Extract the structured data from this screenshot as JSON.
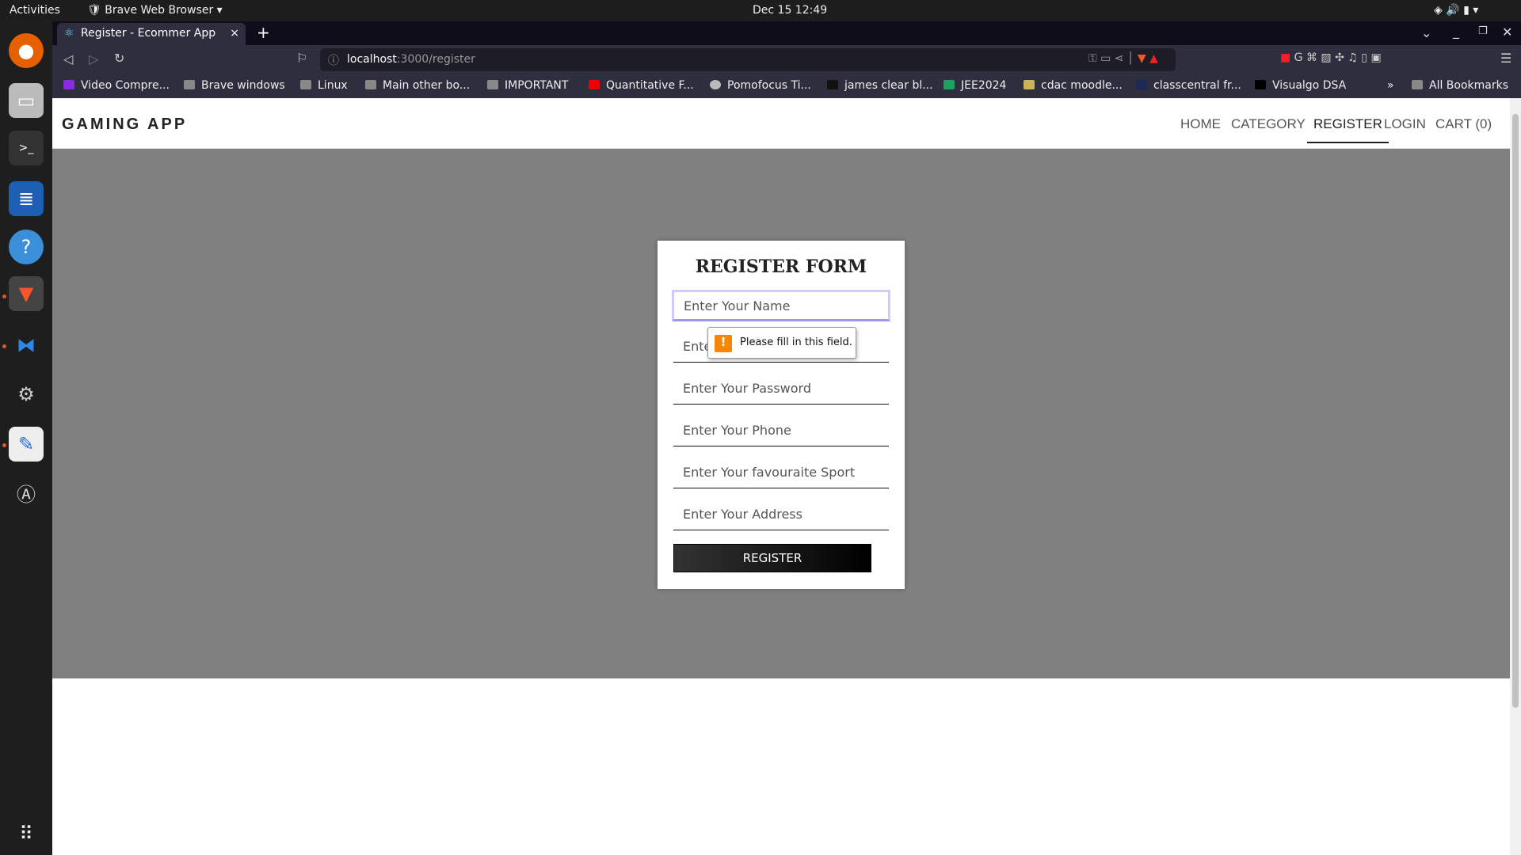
{
  "system": {
    "activities": "Activities",
    "app_name": "Brave Web Browser",
    "datetime": "Dec 15  12:49"
  },
  "browser": {
    "tab_title": "Register - Ecommer App",
    "url_host": "localhost",
    "url_path": ":3000/register",
    "bookmarks": [
      "Video Compre...",
      "Brave windows",
      "Linux",
      "Main other bo...",
      "IMPORTANT",
      "Quantitative F...",
      "Pomofocus Ti...",
      "james clear bl...",
      "JEE2024",
      "cdac moodle...",
      "classcentral fr...",
      "Visualgo DSA"
    ],
    "more": "»",
    "all_bookmarks": "All Bookmarks"
  },
  "header": {
    "brand": "GAMING APP",
    "nav": [
      "HOME",
      "CATEGORY",
      "REGISTER",
      "LOGIN",
      "CART (0)"
    ]
  },
  "form": {
    "title": "REGISTER FORM",
    "placeholders": [
      "Enter Your Name",
      "Enter Your Email",
      "Enter Your Password",
      "Enter Your Phone",
      "Enter Your favouraite Sport",
      "Enter Your Address"
    ],
    "submit": "REGISTER",
    "validation_message": "Please fill in this field."
  }
}
